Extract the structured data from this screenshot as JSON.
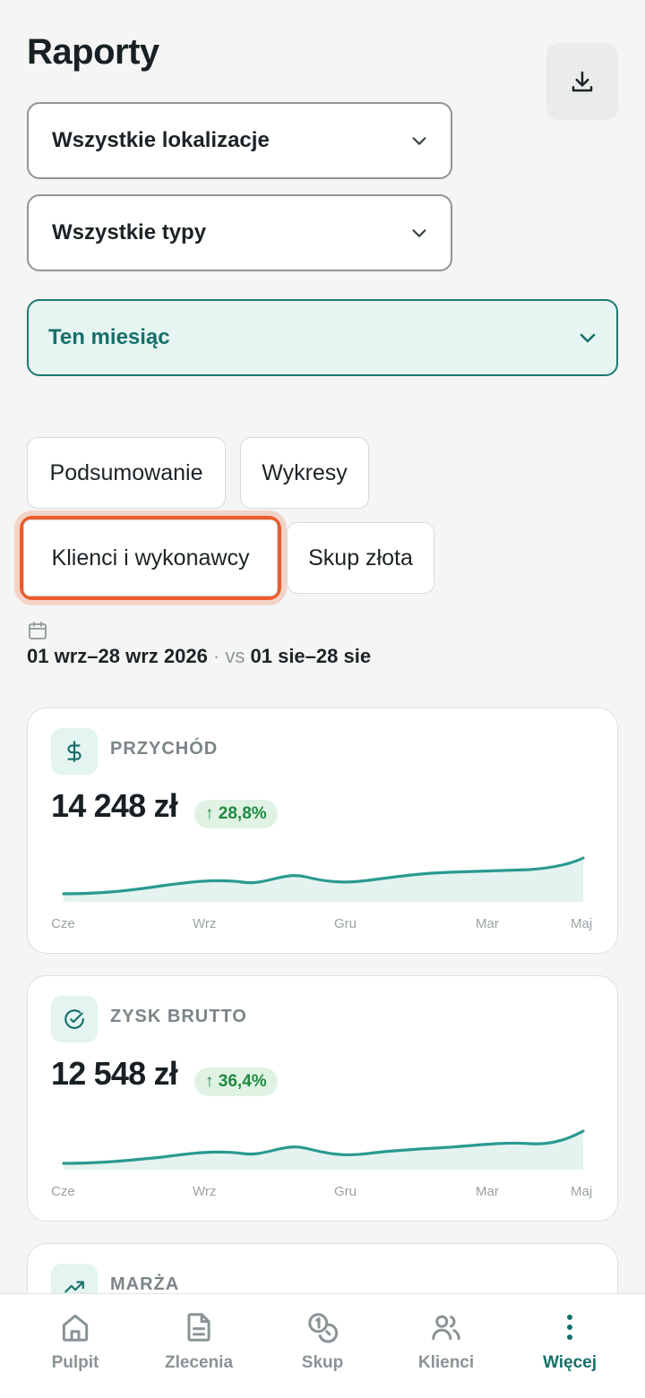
{
  "header": {
    "title": "Raporty",
    "download_icon": "download-icon"
  },
  "filters": {
    "location": "Wszystkie lokalizacje",
    "type": "Wszystkie typy",
    "period": "Ten miesiąc"
  },
  "tabs": [
    {
      "label": "Podsumowanie"
    },
    {
      "label": "Wykresy"
    },
    {
      "label": "Klienci i wykonawcy",
      "selected": true
    },
    {
      "label": "Skup złota"
    }
  ],
  "date_range": {
    "current": "01 wrz–28 wrz 2026",
    "separator": " · ",
    "vs_label": "vs",
    "previous": "01 sie–28 sie"
  },
  "cards": [
    {
      "icon": "dollar-icon",
      "label": "PRZYCHÓD",
      "value": "14 248 zł",
      "change": "↑ 28,8%",
      "axis": [
        "Cze",
        "Wrz",
        "Gru",
        "Mar",
        "Maj"
      ]
    },
    {
      "icon": "check-circle-icon",
      "label": "ZYSK BRUTTO",
      "value": "12 548 zł",
      "change": "↑ 36,4%",
      "axis": [
        "Cze",
        "Wrz",
        "Gru",
        "Mar",
        "Maj"
      ]
    },
    {
      "icon": "trending-up-icon",
      "label": "MARŻA"
    }
  ],
  "nav": [
    {
      "label": "Pulpit",
      "icon": "home-icon"
    },
    {
      "label": "Zlecenia",
      "icon": "document-icon"
    },
    {
      "label": "Skup",
      "icon": "coins-icon"
    },
    {
      "label": "Klienci",
      "icon": "users-icon"
    },
    {
      "label": "Więcej",
      "icon": "more-vertical-icon",
      "active": true
    }
  ],
  "colors": {
    "accent": "#17706a",
    "accent_bg": "#e6f5f2",
    "highlight": "#ef5a2a",
    "positive": "#1f8a40",
    "chart_line": "#2a9a90"
  }
}
